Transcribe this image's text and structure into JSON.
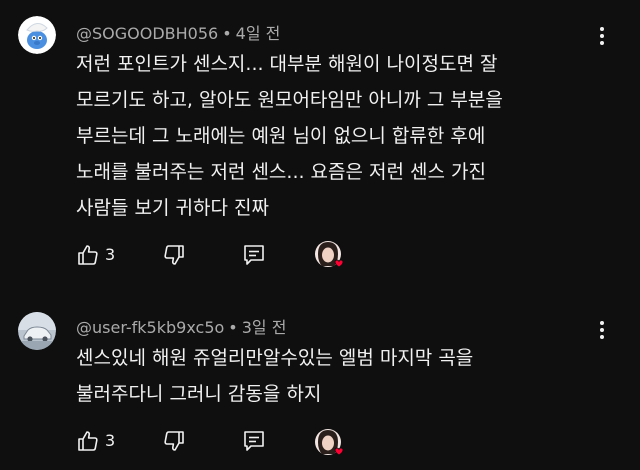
{
  "comments": [
    {
      "author": "@SOGOODBH056",
      "separator": "•",
      "time": "4일 전",
      "lines": [
        "저런 포인트가 센스지... 대부분 해원이 나이정도면 잘",
        "모르기도 하고, 알아도 원모어타임만 아니까 그 부분을",
        "부르는데 그 노래에는 예원 님이 없으니 합류한 후에",
        "노래를 불러주는 저런 센스... 요즘은 저런 센스 가진",
        "사람들 보기 귀하다 진짜"
      ],
      "likes": "3",
      "avatar_icon": "smurf-avatar",
      "heart_color": "#ff0033"
    },
    {
      "author": "@user-fk5kb9xc5o",
      "separator": "•",
      "time": "3일 전",
      "lines": [
        "센스있네 해원 쥬얼리만알수있는 엘범 마지막 곡을",
        "불러주다니 그러니 감동을 하지"
      ],
      "likes": "3",
      "avatar_icon": "car-avatar",
      "heart_color": "#ff0033"
    }
  ],
  "icons": {
    "like": "thumbs-up-icon",
    "dislike": "thumbs-down-icon",
    "reply": "reply-icon",
    "menu": "more-vert-icon"
  }
}
